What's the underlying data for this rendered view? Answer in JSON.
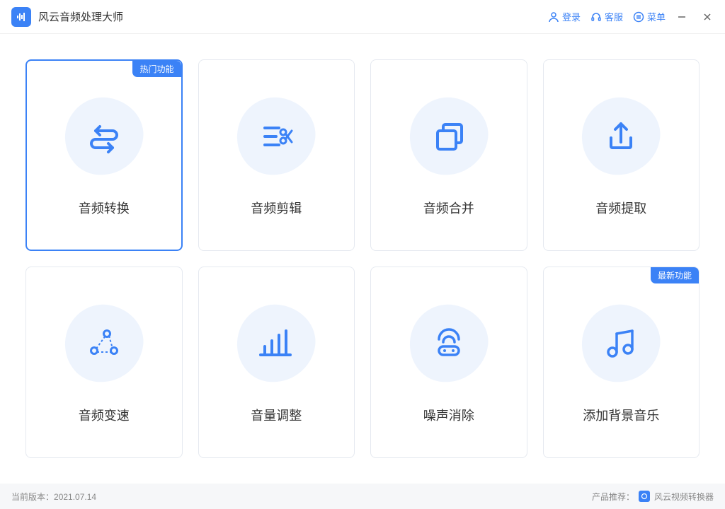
{
  "app": {
    "title": "风云音频处理大师"
  },
  "titlebar": {
    "login": "登录",
    "support": "客服",
    "menu": "菜单"
  },
  "badges": {
    "hot": "热门功能",
    "new": "最新功能"
  },
  "cards": {
    "convert": "音频转换",
    "edit": "音频剪辑",
    "merge": "音频合并",
    "extract": "音频提取",
    "speed": "音频变速",
    "volume": "音量调整",
    "denoise": "噪声消除",
    "bgm": "添加背景音乐"
  },
  "footer": {
    "version_label": "当前版本：",
    "version": "2021.07.14",
    "rec_label": "产品推荐：",
    "rec_product": "风云视频转换器"
  }
}
